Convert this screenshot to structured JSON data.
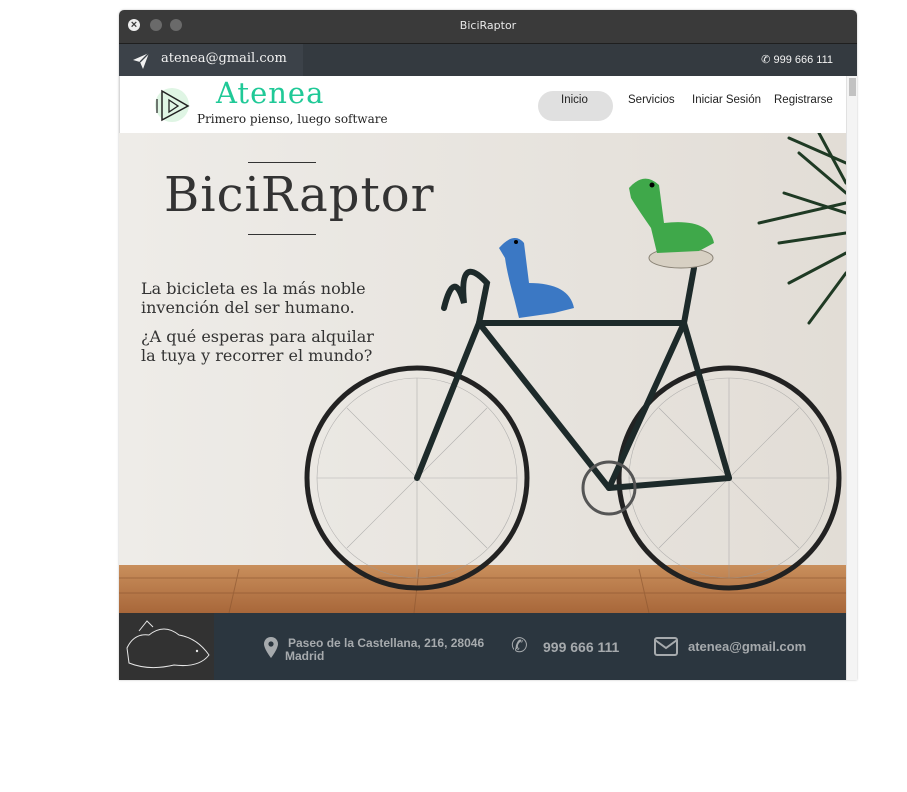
{
  "window": {
    "title": "BiciRaptor"
  },
  "topbar": {
    "email": "atenea@gmail.com",
    "phone": "999 666 111",
    "send_icon": "send-icon",
    "phone_icon": "phone-icon"
  },
  "navbar": {
    "brand": "Atenea",
    "tagline": "Primero pienso, luego software",
    "links": [
      "Inicio",
      "Servicios",
      "Iniciar Sesión",
      "Registrarse"
    ],
    "active": "Inicio",
    "brand_color": "#20c997"
  },
  "hero": {
    "title": "BiciRaptor",
    "line1": "La bicicleta es la más noble invención del ser humano.",
    "line2": "¿A qué esperas para alquilar la tuya y recorrer el mundo?"
  },
  "footer": {
    "address": "Paseo de la Castellana, 216, 28046",
    "city": "Madrid",
    "phone": "999 666 111",
    "email": "atenea@gmail.com",
    "bg_color": "#2b363f"
  }
}
